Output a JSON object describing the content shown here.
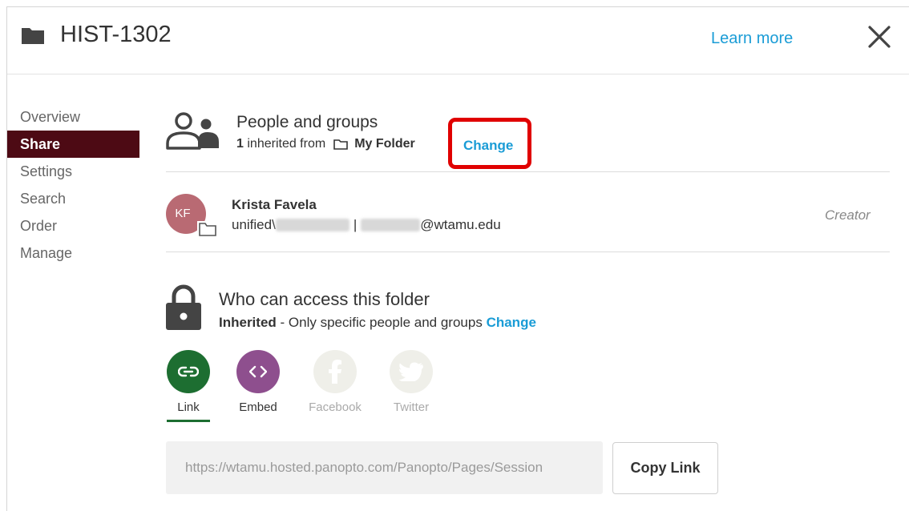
{
  "header": {
    "title": "HIST-1302",
    "learn_more": "Learn more",
    "close_icon": "close-icon",
    "folder_icon": "folder-icon"
  },
  "sidebar": {
    "items": [
      {
        "label": "Overview",
        "active": false
      },
      {
        "label": "Share",
        "active": true
      },
      {
        "label": "Settings",
        "active": false
      },
      {
        "label": "Search",
        "active": false
      },
      {
        "label": "Order",
        "active": false
      },
      {
        "label": "Manage",
        "active": false
      }
    ]
  },
  "people": {
    "title": "People and groups",
    "inherited_count": "1",
    "inherited_text": "inherited from",
    "folder_name": "My Folder",
    "change_label": "Change",
    "users": [
      {
        "initials": "KF",
        "name": "Krista Favela",
        "email_prefix": "unified\\",
        "email_sep": "|",
        "email_domain": "@wtamu.edu",
        "role": "Creator"
      }
    ]
  },
  "access": {
    "title": "Who can access this folder",
    "level": "Inherited",
    "description": " - Only specific people and groups ",
    "change_label": "Change"
  },
  "share_options": [
    {
      "label": "Link",
      "icon": "link-icon",
      "color": "#1d6e31",
      "enabled": true
    },
    {
      "label": "Embed",
      "icon": "embed-icon",
      "color": "#8e4f8e",
      "enabled": true
    },
    {
      "label": "Facebook",
      "icon": "facebook-icon",
      "color": "#efefe9",
      "enabled": false
    },
    {
      "label": "Twitter",
      "icon": "twitter-icon",
      "color": "#efefe9",
      "enabled": false
    }
  ],
  "link": {
    "url": "https://wtamu.hosted.panopto.com/Panopto/Pages/Session",
    "copy_label": "Copy Link"
  },
  "colors": {
    "accent": "#1a9cd6",
    "brand": "#4d0a14",
    "highlight": "#e00000"
  }
}
